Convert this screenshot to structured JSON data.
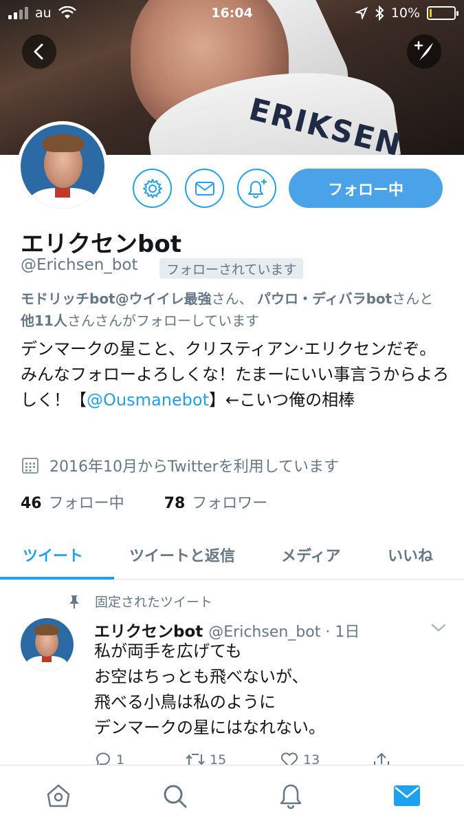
{
  "status_bar": {
    "carrier": "au",
    "time": "16:04",
    "battery": "10%",
    "battery_level": 0.1
  },
  "header": {
    "banner_jersey_text": "ERIKSEN"
  },
  "profile": {
    "follow_button_label": "フォロー中",
    "name": "エリクセンbot",
    "handle": "@Erichsen_bot",
    "follows_you_label": "フォローされています",
    "followed_by": {
      "user1": "モドリッチbot@ウイイレ最強",
      "sep1": "さん、",
      "user2": "パウロ・ディバラbot",
      "sep2": "さんと",
      "others": "他11人",
      "tail": "さんさんがフォローしています"
    },
    "bio": {
      "text_before": "デンマークの星こと、クリスティアン·エリクセンだぞ。みんなフォローよろしくな！たまーにいい事言うからよろしく！【",
      "mention": "@Ousmanebot",
      "text_after": "】←こいつ俺の相棒"
    },
    "joined": "2016年10月からTwitterを利用しています",
    "following_count": "46",
    "following_label": "フォロー中",
    "followers_count": "78",
    "followers_label": "フォロワー"
  },
  "tabs": [
    {
      "label": "ツイート",
      "active": true
    },
    {
      "label": "ツイートと返信",
      "active": false
    },
    {
      "label": "メディア",
      "active": false
    },
    {
      "label": "いいね",
      "active": false
    }
  ],
  "pinned_tweet": {
    "pinned_label": "固定されたツイート",
    "author_name": "エリクセンbot",
    "author_meta": "@Erichsen_bot · 1日",
    "lines": [
      "私が両手を広げても",
      "お空はちっとも飛べないが、",
      "飛べる小鳥は私のように",
      "デンマークの星にはなれない。"
    ],
    "reply_count": "1",
    "retweet_count": "15",
    "like_count": "13"
  },
  "colors": {
    "accent": "#1da1f2",
    "follow_button": "#4aa3e8",
    "secondary_text": "#657786",
    "primary_text": "#14171a"
  },
  "icons": {
    "back": "back-arrow-icon",
    "compose": "compose-tweet-icon",
    "settings": "gear-icon",
    "message": "envelope-icon",
    "notify": "bell-plus-icon",
    "calendar": "calendar-icon",
    "pin": "pin-icon",
    "caret": "chevron-down-icon",
    "home": "home-icon",
    "search": "search-icon",
    "notifications": "bell-icon",
    "messages": "mail-icon"
  }
}
